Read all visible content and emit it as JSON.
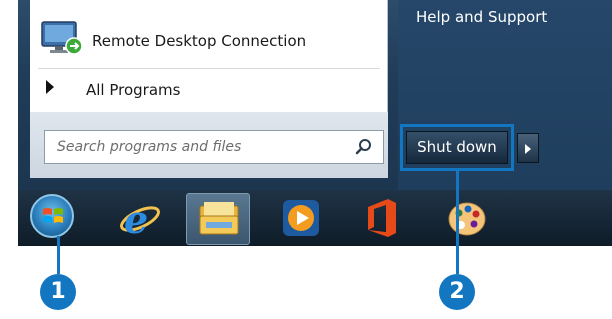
{
  "start_menu": {
    "right_pane": {
      "help_label": "Help and Support"
    },
    "programs": {
      "remote_desktop_label": "Remote Desktop Connection",
      "all_programs_label": "All Programs"
    },
    "search": {
      "placeholder": "Search programs and files"
    },
    "shutdown": {
      "label": "Shut down"
    }
  },
  "taskbar": {
    "icons": [
      "start-orb",
      "internet-explorer-icon",
      "windows-explorer-icon",
      "media-player-icon",
      "office-icon",
      "paint-icon"
    ]
  },
  "callouts": {
    "badge_1": "1",
    "badge_2": "2"
  },
  "colors": {
    "accent": "#1376c1",
    "taskbar": "#0f1c28",
    "menu_dark": "#203c58"
  }
}
